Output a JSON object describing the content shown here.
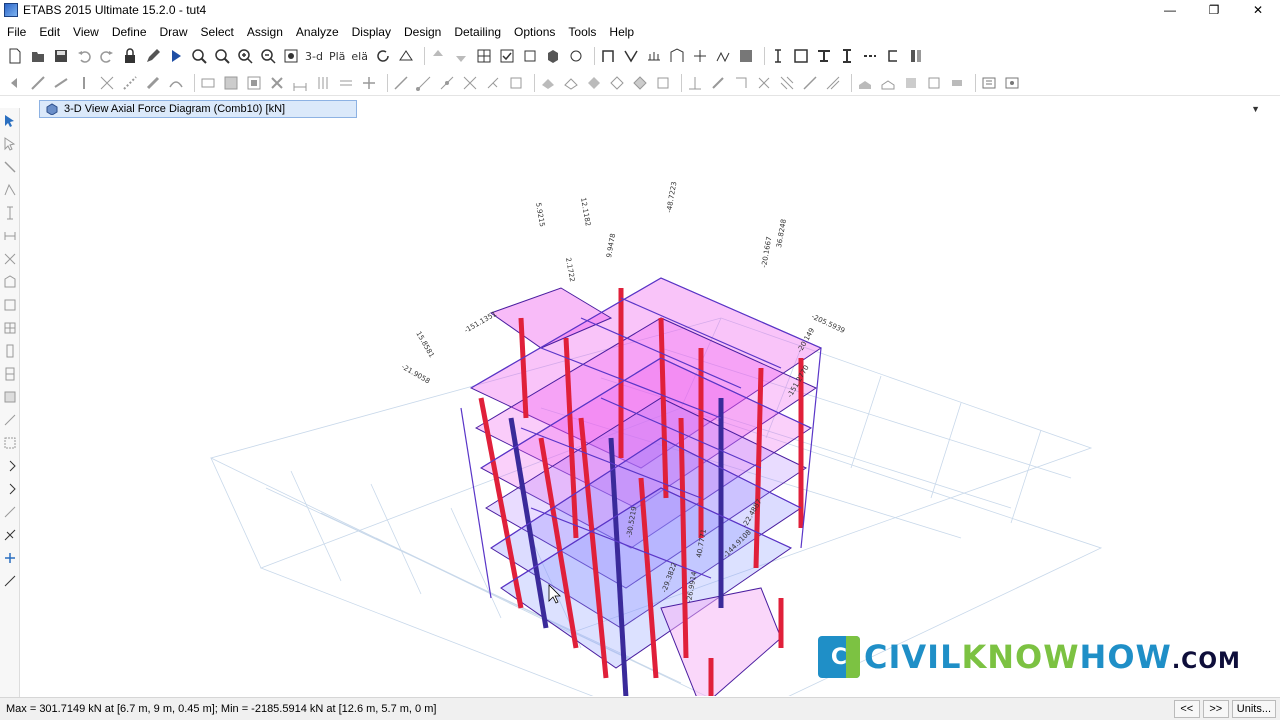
{
  "window": {
    "title": "ETABS 2015 Ultimate 15.2.0 - tut4",
    "minimize": "—",
    "restore": "❐",
    "close": "✕"
  },
  "menu": {
    "items": [
      "File",
      "Edit",
      "View",
      "Define",
      "Draw",
      "Select",
      "Assign",
      "Analyze",
      "Display",
      "Design",
      "Detailing",
      "Options",
      "Tools",
      "Help"
    ]
  },
  "toolbar": {
    "view_3d_label": "3-d",
    "plan_label": "Plä",
    "elev_label": "elä"
  },
  "view": {
    "tab_label": "3-D View   Axial Force Diagram   (Comb10)  [kN]",
    "dropdown_arrow": "▼"
  },
  "model": {
    "frame_labels": [
      "-151.1351",
      "-21.9058",
      "15.8581",
      "12.1182",
      "5.9215",
      "-20.1667",
      "36.8248",
      "-205.5939",
      "-20.149",
      "-151.2770",
      "-22.4887",
      "-144.9108",
      "-26.9914",
      "-29.3822",
      "-30.5219",
      "-48.7223",
      "2.1722",
      "9.9478",
      "40.7771"
    ],
    "colors": {
      "slab": "#ee55ee",
      "column": "#e0203a",
      "beam": "#5a36c8",
      "grid": "#c8d8ea"
    }
  },
  "watermark": {
    "logo_letter": "C",
    "part1": "CIVIL",
    "part2": "KNOW",
    "part3": "HOW",
    "part4": ".COM"
  },
  "status": {
    "text": "Max = 301.7149 kN at [6.7 m, 9 m, 0.45 m];  Min = -2185.5914 kN at [12.6 m, 5.7 m, 0 m]",
    "prev_label": "<<",
    "next_label": ">>",
    "units_label": "Units..."
  }
}
